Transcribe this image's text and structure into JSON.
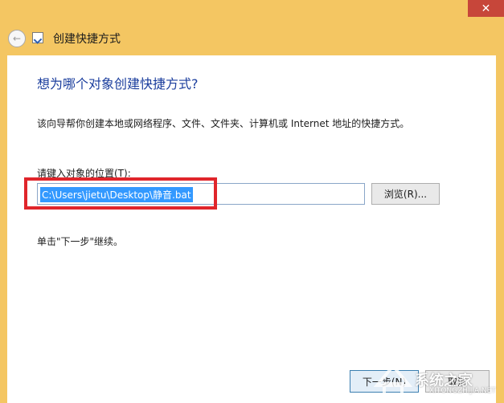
{
  "window": {
    "title": "创建快捷方式",
    "close_glyph": "✕",
    "back_glyph": "←"
  },
  "page": {
    "heading": "想为哪个对象创建快捷方式?",
    "description": "该向导帮你创建本地或网络程序、文件、文件夹、计算机或 Internet 地址的快捷方式。",
    "field_label": "请键入对象的位置(T):",
    "path_value": "C:\\Users\\jietu\\Desktop\\静音.bat",
    "browse_label": "浏览(R)...",
    "hint": "单击\"下一步\"继续。"
  },
  "footer": {
    "next_label": "下一步(N)",
    "cancel_label": "取消"
  },
  "watermark": {
    "text": "系统之家",
    "url": "XITONGZHIJIA.NET"
  },
  "colors": {
    "frame": "#f4c662",
    "heading": "#1a3d9d",
    "highlight": "#e0252b",
    "selection": "#3399ff"
  }
}
